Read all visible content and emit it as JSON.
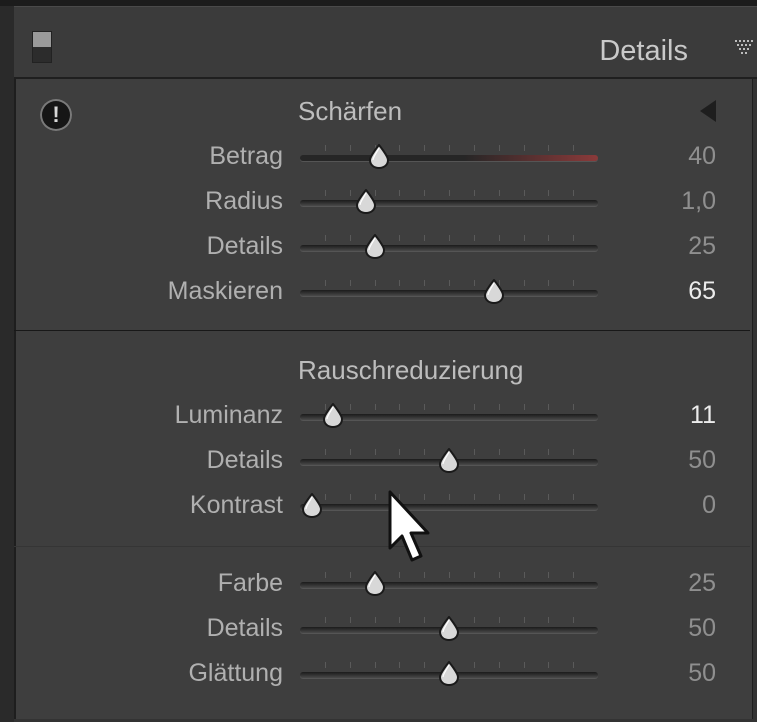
{
  "panel": {
    "title": "Details"
  },
  "sections": {
    "sharpen": {
      "title": "Schärfen",
      "rows": [
        {
          "label": "Betrag",
          "value": "40",
          "fraction": 0.2667,
          "active": false
        },
        {
          "label": "Radius",
          "value": "1,0",
          "fraction": 0.2222,
          "active": false
        },
        {
          "label": "Details",
          "value": "25",
          "fraction": 0.25,
          "active": false
        },
        {
          "label": "Maskieren",
          "value": "65",
          "fraction": 0.65,
          "active": true
        }
      ]
    },
    "noise": {
      "title": "Rauschreduzierung",
      "rows": [
        {
          "label": "Luminanz",
          "value": "11",
          "fraction": 0.11,
          "active": true
        },
        {
          "label": "Details",
          "value": "50",
          "fraction": 0.5,
          "active": false
        },
        {
          "label": "Kontrast",
          "value": "0",
          "fraction": 0.0,
          "active": false
        }
      ]
    },
    "color": {
      "rows": [
        {
          "label": "Farbe",
          "value": "25",
          "fraction": 0.25,
          "active": false
        },
        {
          "label": "Details",
          "value": "50",
          "fraction": 0.5,
          "active": false
        },
        {
          "label": "Glättung",
          "value": "50",
          "fraction": 0.5,
          "active": false
        }
      ]
    }
  },
  "icons": {
    "panel_toggle": "panel-toggle-icon",
    "panel_menu": "triangle-menu-icon",
    "warning": "exclamation-icon",
    "collapse": "collapse-arrow-icon",
    "cursor": "mouse-cursor-icon"
  },
  "colors": {
    "background": "#3e3e3e",
    "label": "#b0b0b0",
    "value_inactive": "#8f8f8f",
    "value_active": "#ececec",
    "betrag_track_accent": "#8a3a3a"
  }
}
